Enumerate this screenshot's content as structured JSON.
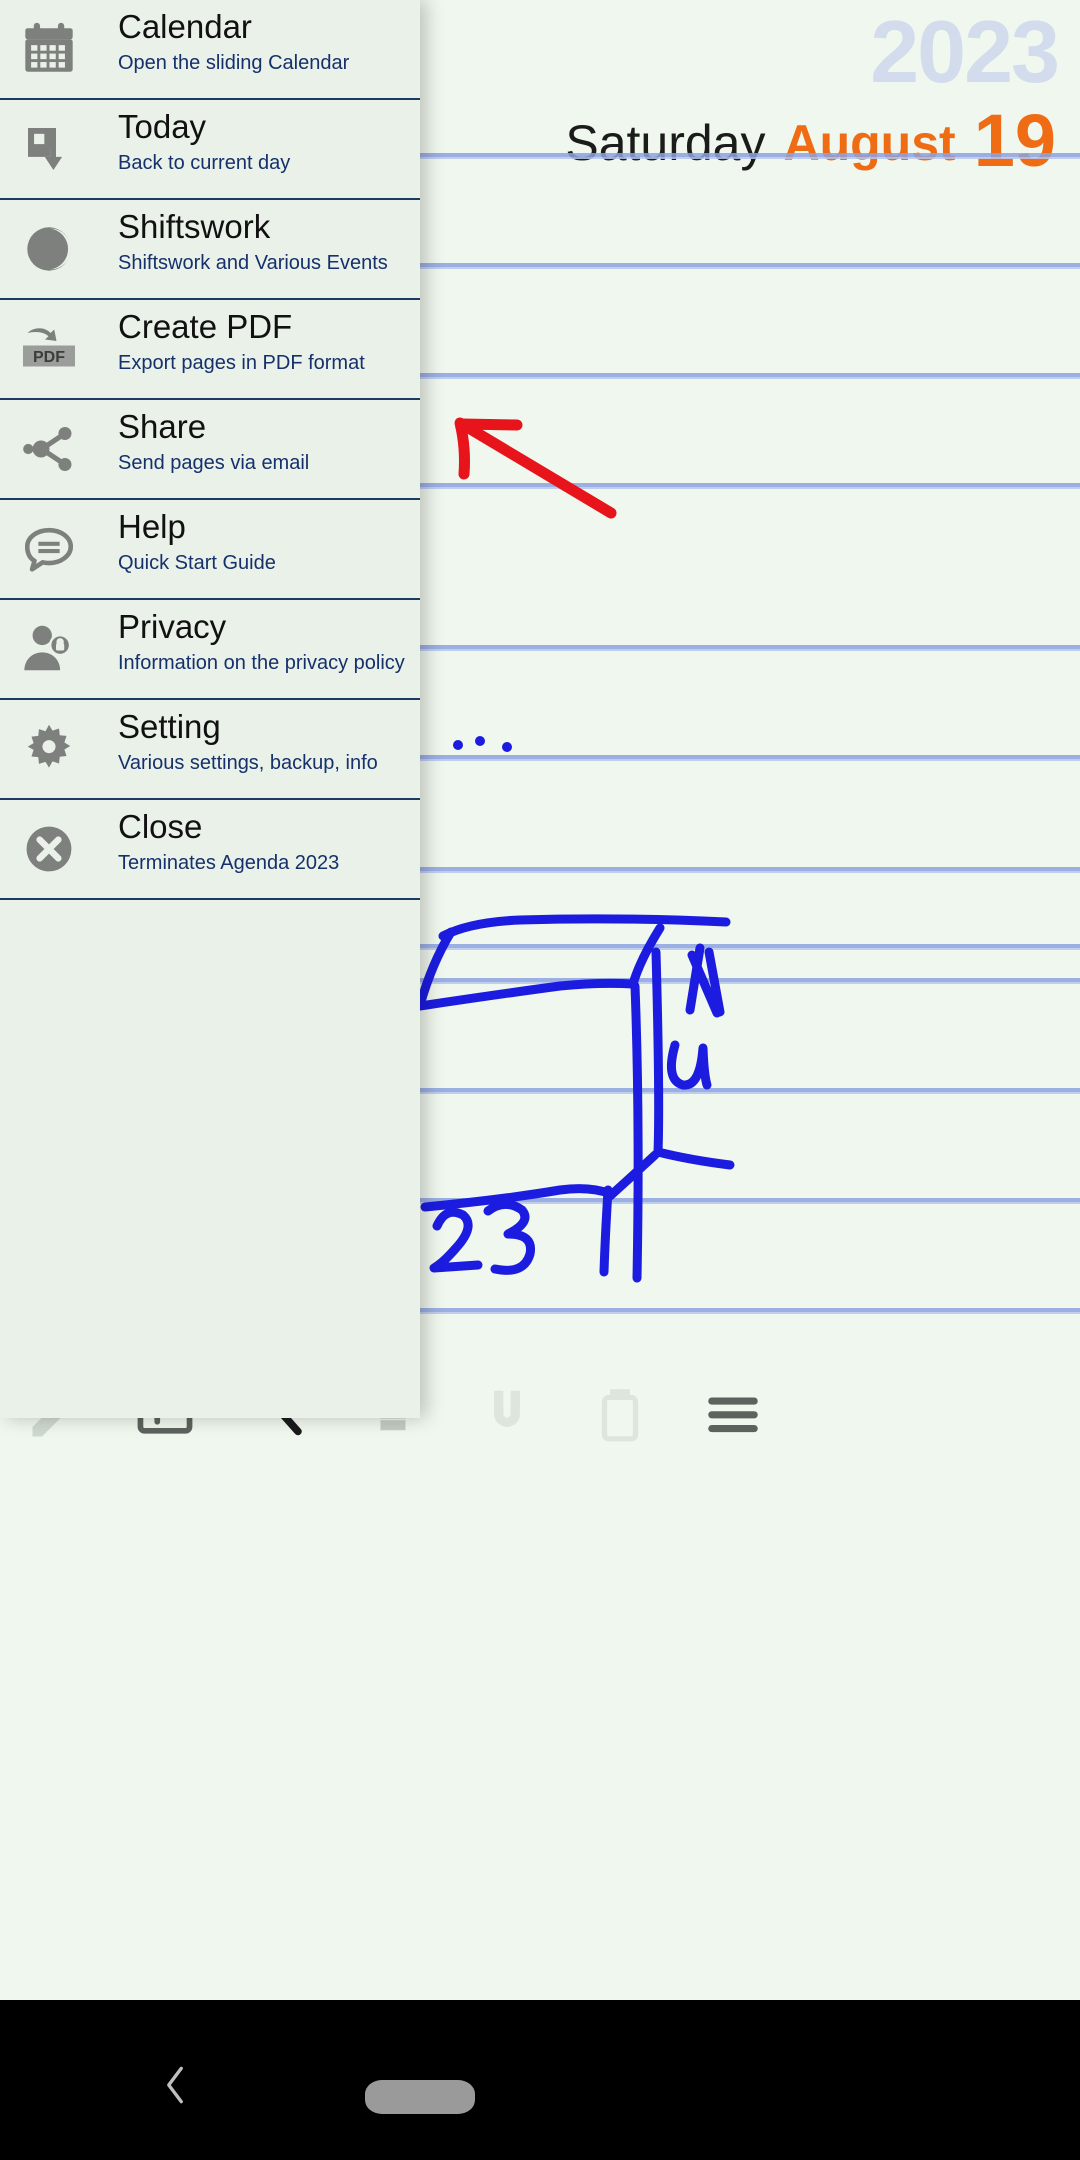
{
  "app": {
    "name": "Agenda 2023"
  },
  "page": {
    "year": "2023",
    "weekday": "Saturday",
    "month": "August",
    "day": "19",
    "colors": {
      "paper": "#eff7ee",
      "rule": "#8da3e0",
      "year_text": "#d3dced",
      "accent_orange": "#ef6c14",
      "menu_bg": "#e9f1e9",
      "menu_divider": "#1d3a66",
      "subtitle_blue": "#16306b",
      "ink_red": "#e8141b",
      "ink_blue": "#1c1ce0"
    },
    "ink_notes": [
      {
        "name": "red-arrow",
        "color": "#e8141b"
      },
      {
        "name": "blue-dots",
        "color": "#1c1ce0"
      },
      {
        "name": "blue-sketch",
        "color": "#1c1ce0"
      },
      {
        "name": "blue-digits-23",
        "color": "#1c1ce0",
        "text": "23"
      },
      {
        "name": "blue-letter-n",
        "color": "#1c1ce0",
        "text": "N"
      },
      {
        "name": "blue-letter-u",
        "color": "#1c1ce0",
        "text": "u"
      }
    ]
  },
  "menu": {
    "items": [
      {
        "id": "calendar",
        "icon": "calendar-icon",
        "title": "Calendar",
        "subtitle": "Open the sliding Calendar"
      },
      {
        "id": "today",
        "icon": "today-icon",
        "title": "Today",
        "subtitle": "Back to current day"
      },
      {
        "id": "shiftswork",
        "icon": "shiftswork-icon",
        "title": "Shiftswork",
        "subtitle": "Shiftswork and Various Events"
      },
      {
        "id": "create-pdf",
        "icon": "pdf-icon",
        "title": "Create PDF",
        "subtitle": "Export pages in PDF format"
      },
      {
        "id": "share",
        "icon": "share-icon",
        "title": "Share",
        "subtitle": "Send pages via email"
      },
      {
        "id": "help",
        "icon": "help-icon",
        "title": "Help",
        "subtitle": "Quick Start Guide"
      },
      {
        "id": "privacy",
        "icon": "privacy-icon",
        "title": "Privacy",
        "subtitle": "Information on the privacy policy"
      },
      {
        "id": "setting",
        "icon": "gear-icon",
        "title": "Setting",
        "subtitle": "Various settings, backup, info"
      },
      {
        "id": "close",
        "icon": "close-icon",
        "title": "Close",
        "subtitle": "Terminates Agenda 2023"
      }
    ]
  },
  "toolbar": {
    "items": [
      {
        "id": "pen",
        "icon": "pen-icon"
      },
      {
        "id": "text",
        "icon": "text-box-icon"
      },
      {
        "id": "eraser",
        "icon": "eraser-icon"
      },
      {
        "id": "highlighter",
        "icon": "highlighter-icon"
      },
      {
        "id": "magnet",
        "icon": "magnet-icon"
      },
      {
        "id": "delete",
        "icon": "trash-icon"
      },
      {
        "id": "menu",
        "icon": "hamburger-icon"
      }
    ]
  },
  "navbar": {
    "items": [
      {
        "id": "back",
        "icon": "back-chevron-icon"
      },
      {
        "id": "home",
        "icon": "home-pill-icon"
      }
    ]
  }
}
